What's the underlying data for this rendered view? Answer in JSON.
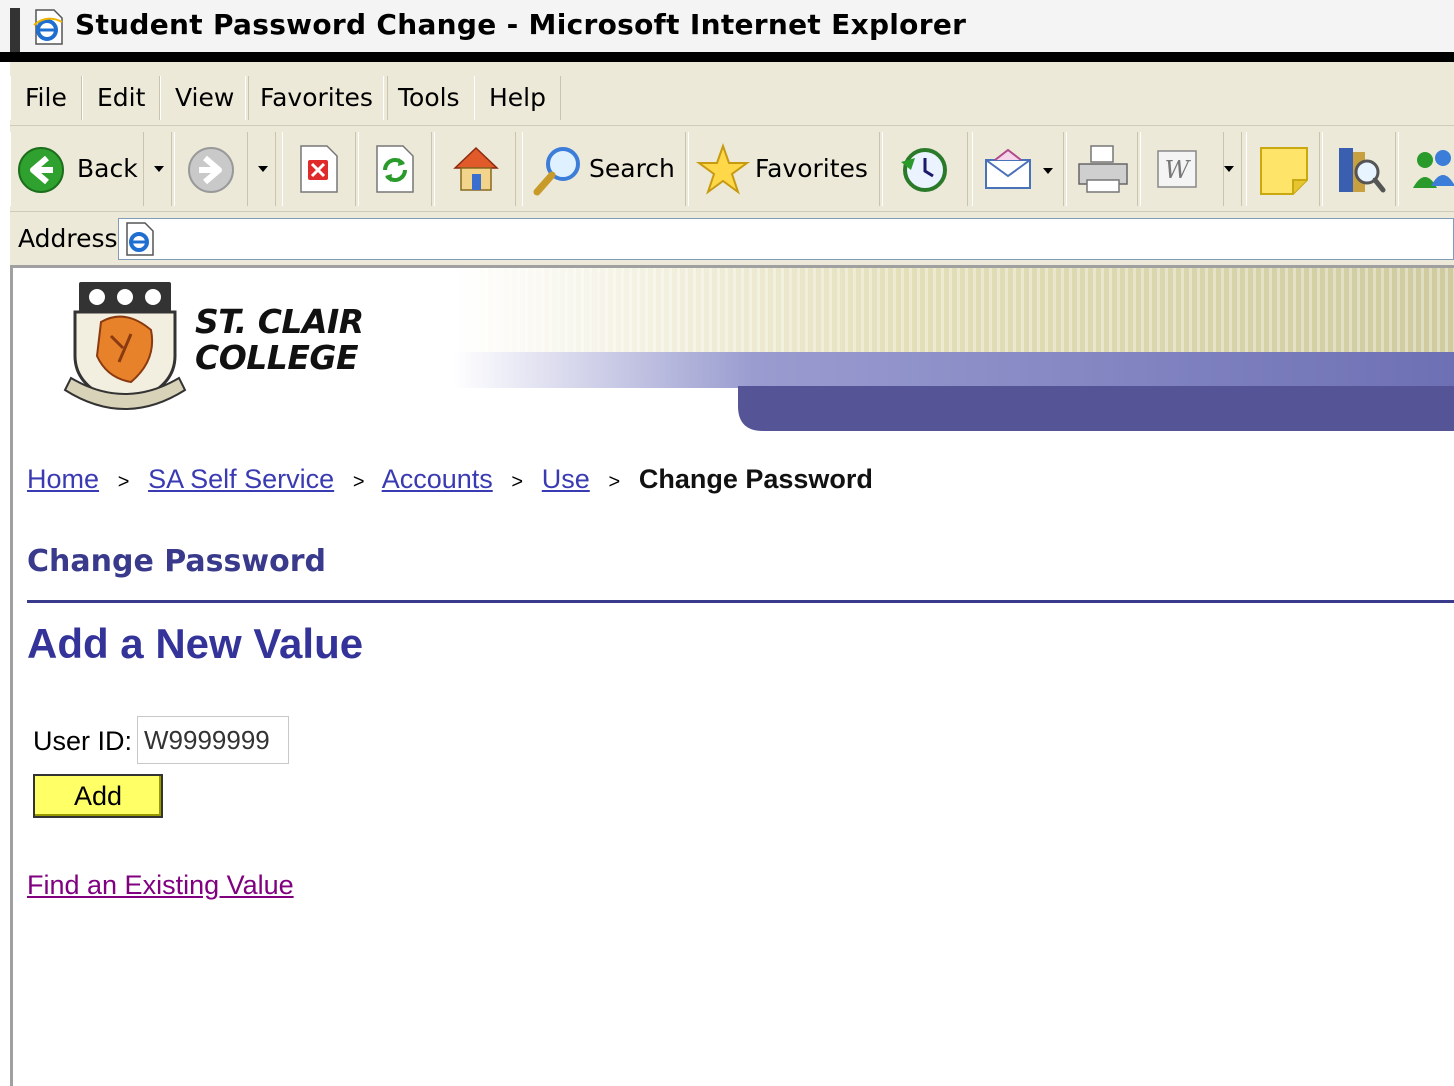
{
  "window": {
    "title": "Student Password Change - Microsoft Internet Explorer"
  },
  "menubar": {
    "items": [
      {
        "label": "File"
      },
      {
        "label": "Edit"
      },
      {
        "label": "View"
      },
      {
        "label": "Favorites"
      },
      {
        "label": "Tools"
      },
      {
        "label": "Help"
      }
    ]
  },
  "toolbar": {
    "back_label": "Back",
    "search_label": "Search",
    "favorites_label": "Favorites"
  },
  "addressbar": {
    "label": "Address"
  },
  "banner": {
    "college_line1": "ST. CLAIR",
    "college_line2": "COLLEGE"
  },
  "breadcrumb": {
    "items": [
      {
        "label": "Home"
      },
      {
        "label": "SA Self Service"
      },
      {
        "label": "Accounts"
      },
      {
        "label": "Use"
      }
    ],
    "separator": ">",
    "current": "Change Password"
  },
  "page": {
    "heading": "Change Password",
    "subheading": "Add a New Value",
    "userid_label": "User ID:",
    "userid_value": "W9999999",
    "add_button": "Add",
    "find_link": "Find an Existing Value"
  },
  "colors": {
    "heading": "#3a3a8c",
    "link": "#3a3ab3",
    "visited_link": "#800080",
    "button": "#ffff66",
    "banner_band": "#545497"
  }
}
